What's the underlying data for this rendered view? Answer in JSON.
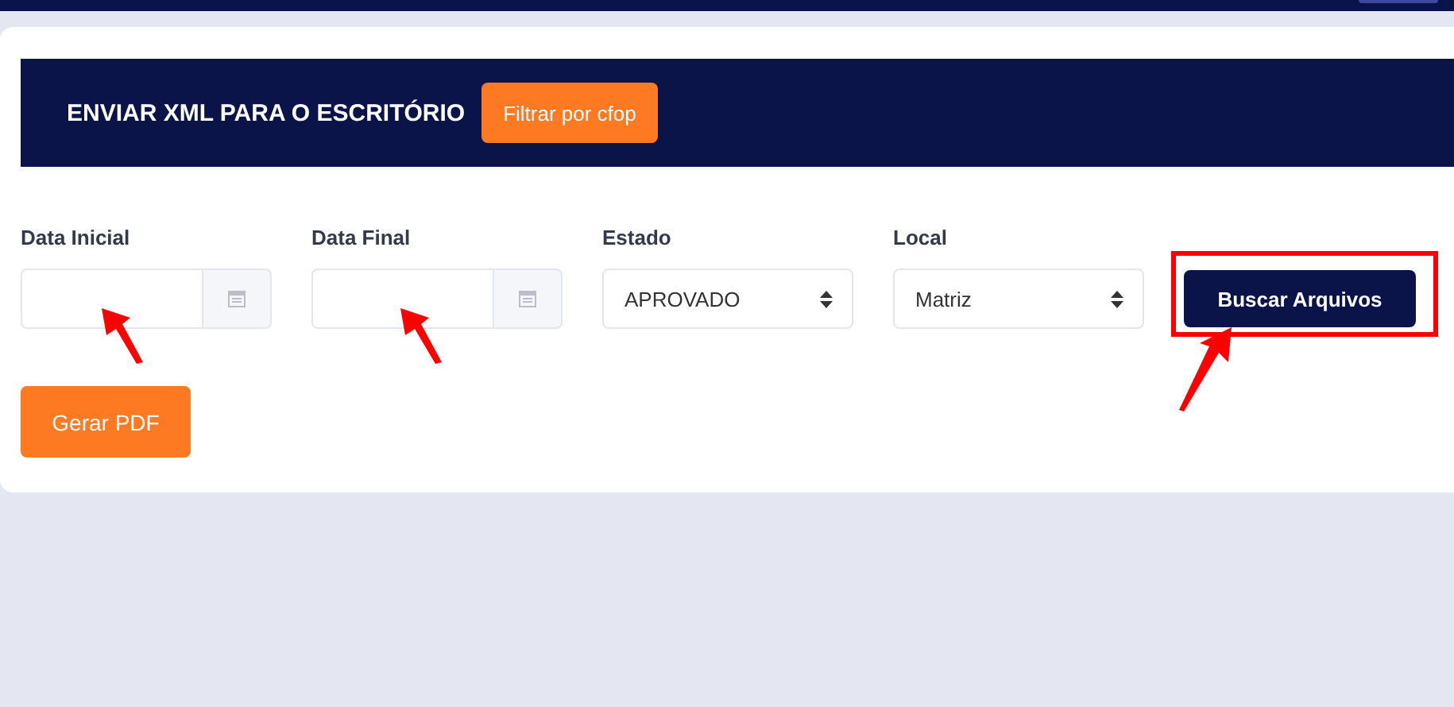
{
  "header": {
    "title": "ENVIAR XML PARA O ESCRITÓRIO",
    "filter_button": "Filtrar por cfop"
  },
  "fields": [
    {
      "kind": "date",
      "label": "Data Inicial"
    },
    {
      "kind": "date",
      "label": "Data Final"
    },
    {
      "kind": "select",
      "label": "Estado",
      "value": "APROVADO"
    },
    {
      "kind": "select",
      "label": "Local",
      "value": "Matriz"
    }
  ],
  "search_button": "Buscar Arquivos",
  "pdf_button": "Gerar PDF"
}
